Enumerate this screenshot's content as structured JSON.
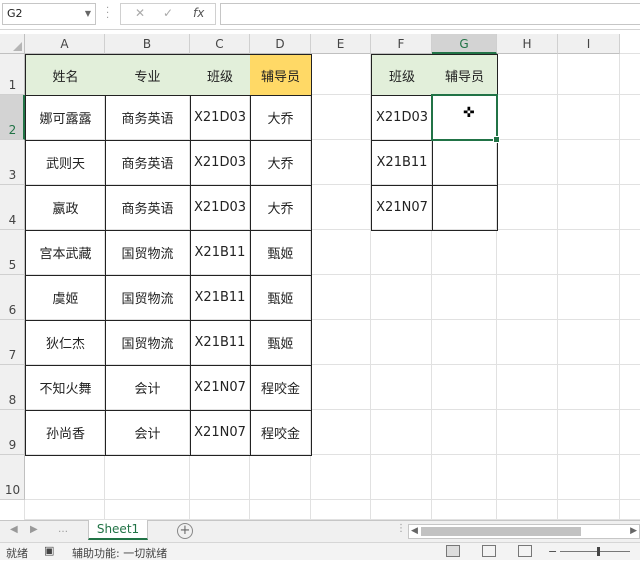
{
  "formula_bar": {
    "name_box": "G2",
    "cancel_icon": "✕",
    "enter_icon": "✓",
    "fx_icon": "fx",
    "formula": ""
  },
  "columns": [
    "A",
    "B",
    "C",
    "D",
    "E",
    "F",
    "G",
    "H",
    "I"
  ],
  "rows": [
    "1",
    "2",
    "3",
    "4",
    "5",
    "6",
    "7",
    "8",
    "9",
    "10"
  ],
  "table_left": {
    "headers": [
      "姓名",
      "专业",
      "班级",
      "辅导员"
    ],
    "rows": [
      [
        "娜可露露",
        "商务英语",
        "X21D03",
        "大乔"
      ],
      [
        "武则天",
        "商务英语",
        "X21D03",
        "大乔"
      ],
      [
        "嬴政",
        "商务英语",
        "X21D03",
        "大乔"
      ],
      [
        "宫本武藏",
        "国贸物流",
        "X21B11",
        "甄姬"
      ],
      [
        "虞姬",
        "国贸物流",
        "X21B11",
        "甄姬"
      ],
      [
        "狄仁杰",
        "国贸物流",
        "X21B11",
        "甄姬"
      ],
      [
        "不知火舞",
        "会计",
        "X21N07",
        "程咬金"
      ],
      [
        "孙尚香",
        "会计",
        "X21N07",
        "程咬金"
      ]
    ]
  },
  "table_right": {
    "headers": [
      "班级",
      "辅导员"
    ],
    "rows": [
      [
        "X21D03",
        ""
      ],
      [
        "X21B11",
        ""
      ],
      [
        "X21N07",
        ""
      ]
    ]
  },
  "selected_cell": "G2",
  "sheet_tabs": {
    "active": "Sheet1",
    "add_icon": "+"
  },
  "status_bar": {
    "ready": "就绪",
    "accessibility": "辅助功能: 一切就绪"
  },
  "colors": {
    "header_fill": "#e2efda",
    "highlight_fill": "#ffd966",
    "accent": "#217346"
  }
}
